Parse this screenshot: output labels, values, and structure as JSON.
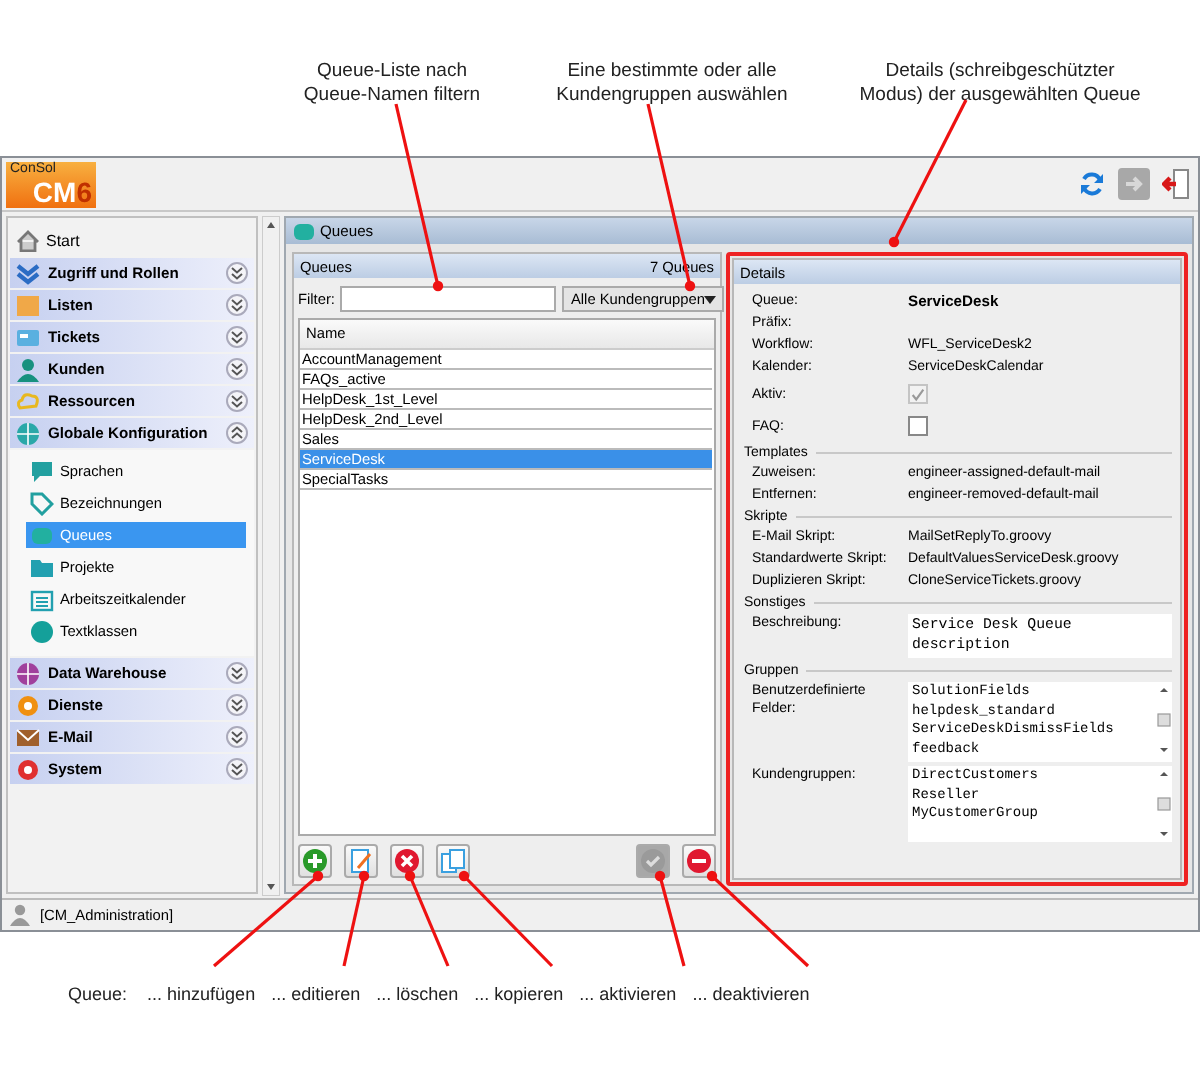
{
  "callouts_top": [
    {
      "text": "Queue-Liste nach\nQueue-Namen filtern"
    },
    {
      "text": "Eine bestimmte oder alle\nKundengruppen auswählen"
    },
    {
      "text": "Details (schreibgeschützter\nModus) der ausgewählten Queue"
    }
  ],
  "logo": {
    "brand": "ConSol",
    "product": "CM",
    "version": "6"
  },
  "sidebar": {
    "start": "Start",
    "sections": [
      {
        "label": "Zugriff und Rollen",
        "expanded": false
      },
      {
        "label": "Listen",
        "expanded": false
      },
      {
        "label": "Tickets",
        "expanded": false
      },
      {
        "label": "Kunden",
        "expanded": false
      },
      {
        "label": "Ressourcen",
        "expanded": false
      },
      {
        "label": "Globale Konfiguration",
        "expanded": true,
        "children": [
          {
            "label": "Sprachen",
            "selected": false
          },
          {
            "label": "Bezeichnungen",
            "selected": false
          },
          {
            "label": "Queues",
            "selected": true
          },
          {
            "label": "Projekte",
            "selected": false
          },
          {
            "label": "Arbeitszeitkalender",
            "selected": false
          },
          {
            "label": "Textklassen",
            "selected": false
          }
        ]
      },
      {
        "label": "Data Warehouse",
        "expanded": false
      },
      {
        "label": "Dienste",
        "expanded": false
      },
      {
        "label": "E-Mail",
        "expanded": false
      },
      {
        "label": "System",
        "expanded": false
      }
    ]
  },
  "main": {
    "title": "Queues",
    "list": {
      "title": "Queues",
      "count": "7 Queues",
      "filter_label": "Filter:",
      "group_filter": "Alle Kundengruppen",
      "column": "Name",
      "rows": [
        {
          "name": "AccountManagement",
          "selected": false
        },
        {
          "name": "FAQs_active",
          "selected": false
        },
        {
          "name": "HelpDesk_1st_Level",
          "selected": false
        },
        {
          "name": "HelpDesk_2nd_Level",
          "selected": false
        },
        {
          "name": "Sales",
          "selected": false
        },
        {
          "name": "ServiceDesk",
          "selected": true
        },
        {
          "name": "SpecialTasks",
          "selected": false
        }
      ]
    },
    "buttons": [
      {
        "kind": "add",
        "disabled": false
      },
      {
        "kind": "edit",
        "disabled": false
      },
      {
        "kind": "delete",
        "disabled": false
      },
      {
        "kind": "copy",
        "disabled": false
      },
      {
        "kind": "activate",
        "disabled": true
      },
      {
        "kind": "deactivate",
        "disabled": false
      }
    ],
    "details": {
      "title": "Details",
      "groups": [
        {
          "fields": [
            {
              "kind": "bold",
              "label": "Queue:",
              "value": "ServiceDesk"
            },
            {
              "kind": "text",
              "label": "Präfix:"
            },
            {
              "kind": "text",
              "label": "Workflow:",
              "value": "WFL_ServiceDesk2"
            },
            {
              "kind": "text",
              "label": "Kalender:",
              "value": "ServiceDeskCalendar"
            },
            {
              "kind": "checkbox",
              "label": "Aktiv:",
              "checked": true,
              "disabled": true
            },
            {
              "kind": "checkbox",
              "label": "FAQ:",
              "checked": false,
              "disabled": false
            }
          ]
        },
        {
          "title": "Templates",
          "fields": [
            {
              "kind": "text",
              "label": "Zuweisen:",
              "value": "engineer-assigned-default-mail"
            },
            {
              "kind": "text",
              "label": "Entfernen:",
              "value": "engineer-removed-default-mail"
            }
          ]
        },
        {
          "title": "Skripte",
          "fields": [
            {
              "kind": "text",
              "label": "E-Mail Skript:",
              "value": "MailSetReplyTo.groovy"
            },
            {
              "kind": "text",
              "label": "Standardwerte Skript:",
              "value": "DefaultValuesServiceDesk.groovy"
            },
            {
              "kind": "text",
              "label": "Duplizieren Skript:",
              "value": "CloneServiceTickets.groovy"
            }
          ]
        },
        {
          "title": "Sonstiges",
          "fields": [
            {
              "kind": "textarea",
              "label": "Beschreibung:",
              "value": "Service Desk Queue description"
            }
          ]
        },
        {
          "title": "Gruppen",
          "fields": [
            {
              "kind": "list",
              "label": "Benutzerdefinierte Felder:",
              "values": [
                "SolutionFields",
                "helpdesk_standard",
                "ServiceDeskDismissFields",
                "feedback"
              ]
            },
            {
              "kind": "list",
              "label": "Kundengruppen:",
              "values": [
                "DirectCustomers",
                "Reseller",
                "MyCustomerGroup"
              ]
            }
          ]
        }
      ]
    }
  },
  "status_bar": {
    "user": "[CM_Administration]"
  },
  "callouts_bottom": {
    "prefix": "Queue:",
    "items": [
      "... hinzufügen",
      "... editieren",
      "... löschen",
      "... kopieren",
      "... aktivieren",
      "... deaktivieren"
    ]
  }
}
